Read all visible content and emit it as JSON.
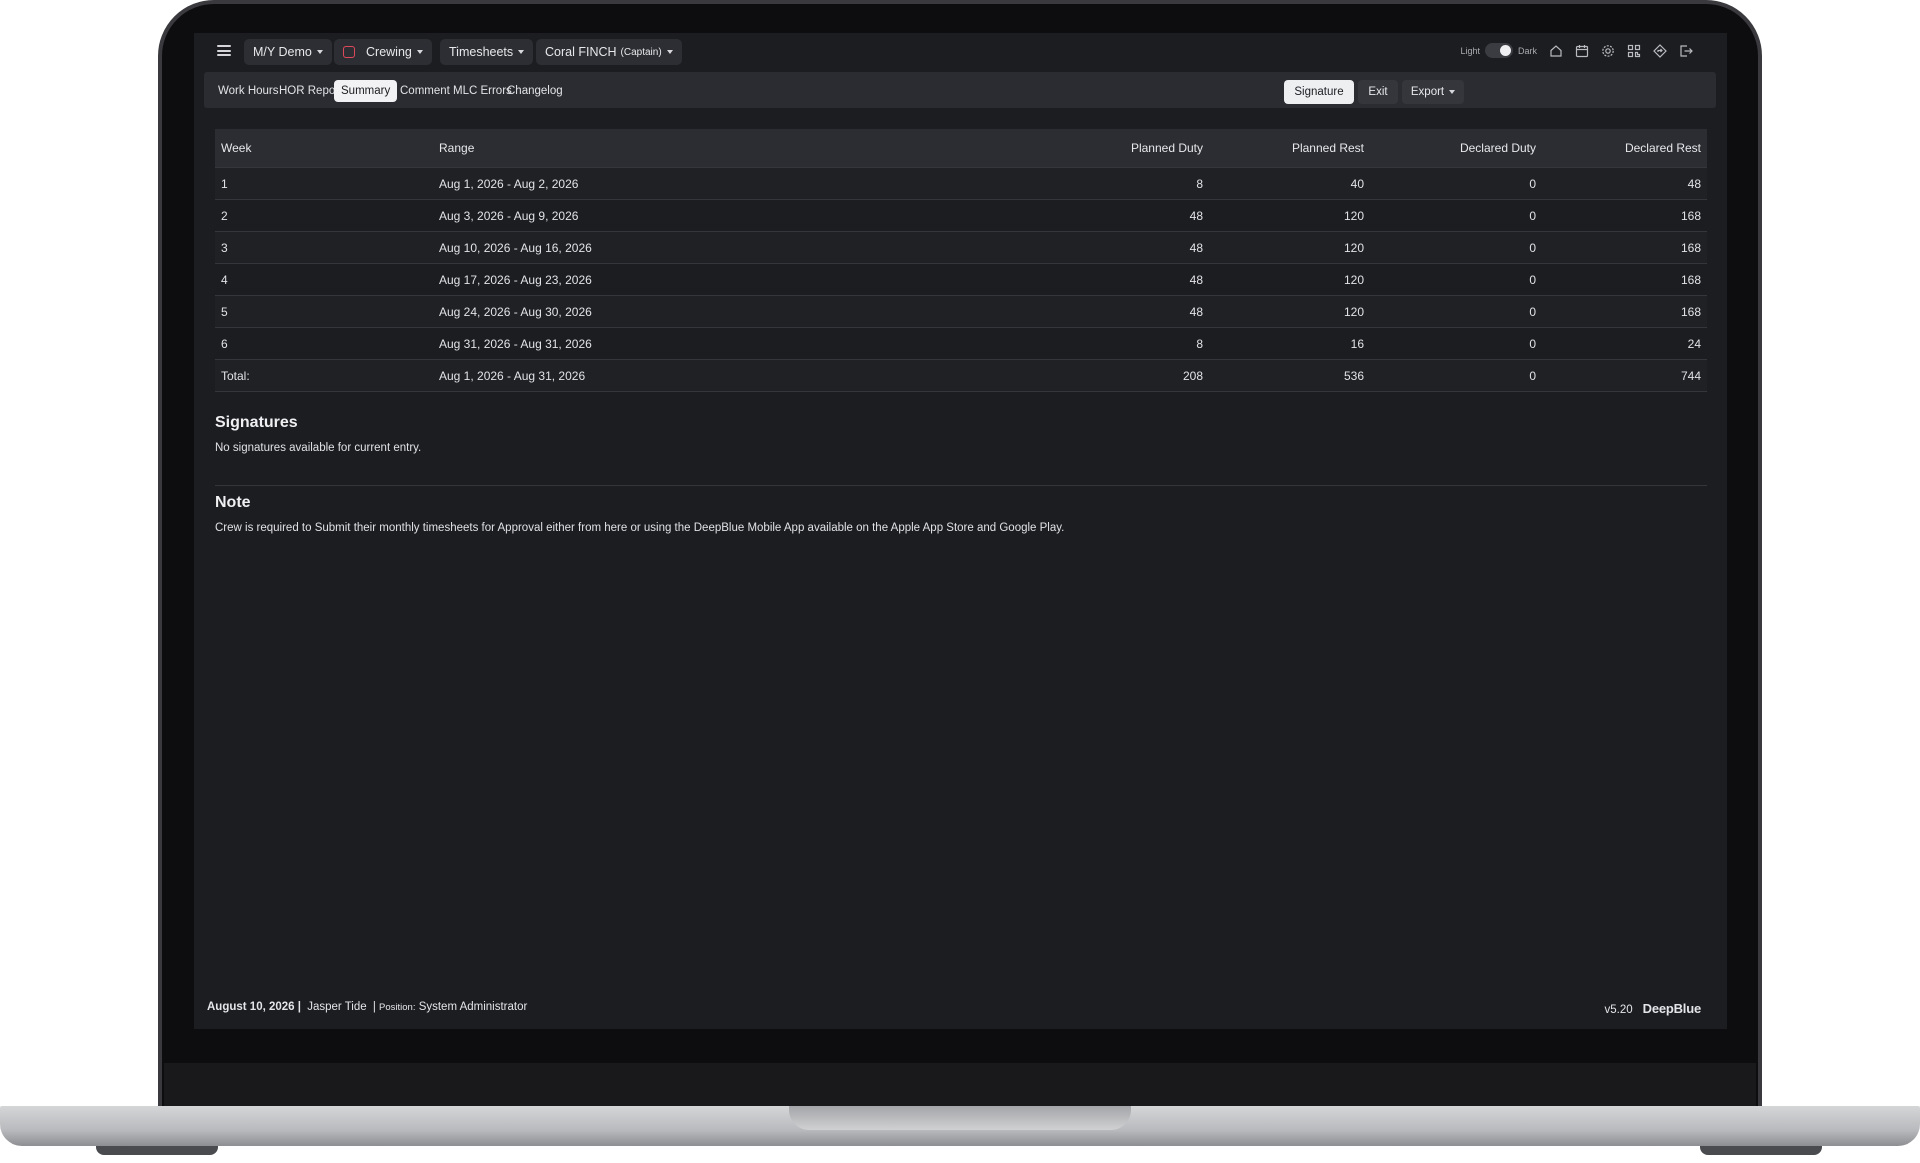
{
  "topbar": {
    "vessel": "M/Y Demo",
    "module": "Crewing",
    "section": "Timesheets",
    "crew_name": "Coral FINCH",
    "crew_role": "(Captain)",
    "theme_light_label": "Light",
    "theme_dark_label": "Dark",
    "icons": [
      "home-icon",
      "calendar-icon",
      "gear-icon",
      "qr-code-icon",
      "diamond-nav-icon",
      "logout-icon"
    ]
  },
  "tabs": [
    {
      "label": "Work Hours"
    },
    {
      "label": "HOR Report"
    },
    {
      "label": "Summary",
      "active": true
    },
    {
      "label": "Comment"
    },
    {
      "label": "MLC Errors"
    },
    {
      "label": "Changelog"
    }
  ],
  "actions": {
    "signature": "Signature",
    "exit": "Exit",
    "export": "Export"
  },
  "table": {
    "headers": [
      "Week",
      "Range",
      "Planned Duty",
      "Planned Rest",
      "Declared Duty",
      "Declared Rest"
    ],
    "rows": [
      [
        "1",
        "Aug 1, 2026 - Aug 2, 2026",
        "8",
        "40",
        "0",
        "48"
      ],
      [
        "2",
        "Aug 3, 2026 - Aug 9, 2026",
        "48",
        "120",
        "0",
        "168"
      ],
      [
        "3",
        "Aug 10, 2026 - Aug 16, 2026",
        "48",
        "120",
        "0",
        "168"
      ],
      [
        "4",
        "Aug 17, 2026 - Aug 23, 2026",
        "48",
        "120",
        "0",
        "168"
      ],
      [
        "5",
        "Aug 24, 2026 - Aug 30, 2026",
        "48",
        "120",
        "0",
        "168"
      ],
      [
        "6",
        "Aug 31, 2026 - Aug 31, 2026",
        "8",
        "16",
        "0",
        "24"
      ],
      [
        "Total:",
        "Aug 1, 2026 - Aug 31, 2026",
        "208",
        "536",
        "0",
        "744"
      ]
    ]
  },
  "signatures": {
    "title": "Signatures",
    "text": "No signatures available for current entry."
  },
  "note": {
    "title": "Note",
    "text": "Crew is required to Submit their monthly timesheets for Approval either from here or using the DeepBlue Mobile App available on the Apple App Store and Google Play."
  },
  "footer": {
    "date": "August 10, 2026 |",
    "user": "Jasper Tide",
    "sep": "|",
    "position_label": "Position:",
    "position": "System Administrator",
    "version": "v5.20",
    "brand": "DeepBlue"
  },
  "colors": {
    "background": "#1c1d21",
    "accent_red": "#e0495a"
  }
}
